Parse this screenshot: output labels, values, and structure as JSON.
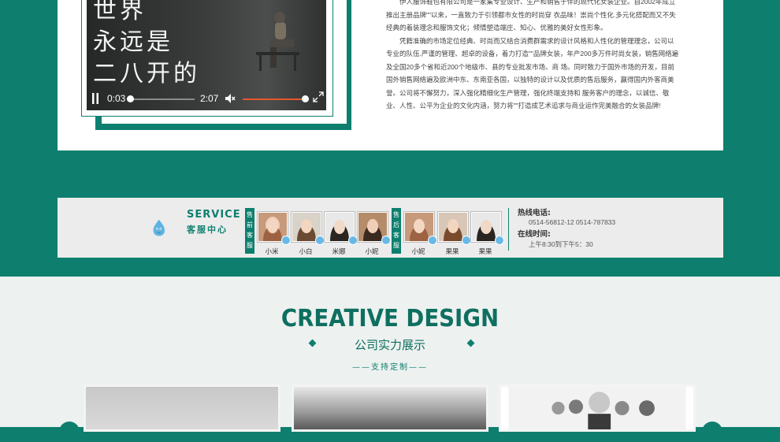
{
  "video": {
    "caption_lines": [
      "世界",
      "永远是",
      "二八开的"
    ],
    "current_time": "0:03",
    "duration": "2:07",
    "icons": [
      "pause-icon",
      "mute-icon",
      "fullscreen-icon"
    ],
    "progress": 0.02,
    "volume": 1.0
  },
  "about": {
    "paragraph1": "伊人服饰鞋包有限公司是一家集专业设计、生产和销售于伴的现代化女装企业。自2002年成立推出主册品牌\"\"以来，一直致力于引领都市女性的时尚穿 衣品味！崇尚个性化.多元化搭配而又不失经典的着装理念和服饰文化；倾情塑造端庄、知心、优雅的美好女性形象。",
    "paragraph2": "凭籍准确的市场定位经典、时尚而又结合消费群需求的设计风格和人性化的管理理念，公司以专业的队伍.严谨的管理、超卓的设备，着力打造\"\"品牌女装，年产200多万件时尚女装，销售网络遍及全国20多个省和近200个地级市、县的专业批发市场、商 场。同时致力于国外市场的开发，目前国外销售网络遍及欧洲中东、东南亚各国，以独特的设计以及优质的售后服务，赢得国内外客商美誉。公司将不懈努力，深入强化精细化生产管理，强化终端支持和 服务客户的理念，以诚信、敬业、人性、公平为企业的文化内涵，努力将\"\"打造成艺术追求与商业运作完美融合的女装品牌!"
  },
  "service": {
    "title_en": "SERVICE",
    "title_cn": "客服中心",
    "presale_tag": "售前客服",
    "aftersale_tag": "售后客服",
    "presale_agents": [
      "小米",
      "小白",
      "米娜",
      "小妮"
    ],
    "aftersale_agents": [
      "小妮",
      "果果",
      "果果"
    ],
    "hotline_label": "热线电话:",
    "hotline_value": "0514-56812-12 0514-787833",
    "hours_label": "在线时间:",
    "hours_value": "上午8:30到下午5：30"
  },
  "showcase": {
    "title": "CREATIVE DESIGN",
    "subtitle": "公司实力展示",
    "support": "——支持定制——"
  },
  "colors": {
    "brand_green": "#0e7f6e",
    "light_gray": "#ececec",
    "page_bottom": "#edf1ef"
  }
}
